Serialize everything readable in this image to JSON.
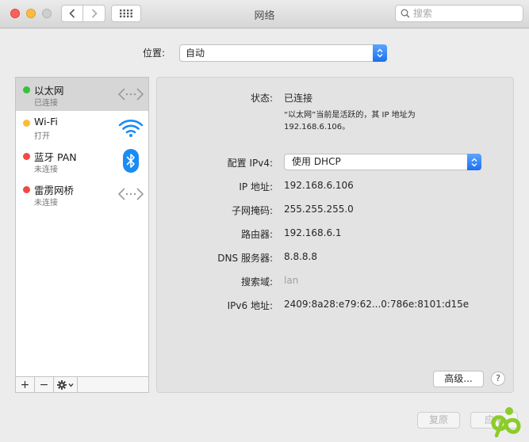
{
  "window": {
    "title": "网络",
    "search_placeholder": "搜索"
  },
  "location": {
    "label": "位置:",
    "value": "自动"
  },
  "services": [
    {
      "name": "以太网",
      "status": "已连接",
      "status_color": "#36c23b",
      "icon": "ethernet-arrows-icon"
    },
    {
      "name": "Wi-Fi",
      "status": "打开",
      "status_color": "#fbbc33",
      "icon": "wifi-icon"
    },
    {
      "name": "蓝牙 PAN",
      "status": "未连接",
      "status_color": "#f24a43",
      "icon": "bluetooth-icon"
    },
    {
      "name": "雷雳网桥",
      "status": "未连接",
      "status_color": "#f24a43",
      "icon": "ethernet-arrows-icon"
    }
  ],
  "toolbar": {
    "add": "+",
    "remove": "−"
  },
  "detail": {
    "status_label": "状态:",
    "status_value": "已连接",
    "status_desc_1": "“以太网”当前是活跃的，其 IP 地址为",
    "status_desc_2": "192.168.6.106。",
    "config_label": "配置 IPv4:",
    "config_value": "使用 DHCP",
    "ip_label": "IP 地址:",
    "ip_value": "192.168.6.106",
    "mask_label": "子网掩码:",
    "mask_value": "255.255.255.0",
    "router_label": "路由器:",
    "router_value": "192.168.6.1",
    "dns_label": "DNS 服务器:",
    "dns_value": "8.8.8.8",
    "search_domain_label": "搜索域:",
    "search_domain_value": "lan",
    "ipv6_label": "IPv6 地址:",
    "ipv6_value": "2409:8a28:e79:62...0:786e:8101:d15e",
    "advanced_label": "高级...",
    "help_label": "?"
  },
  "footer": {
    "revert_label": "复原",
    "apply_label": "应用"
  },
  "colors": {
    "accent": "#1e6ff2",
    "selected_row": "#d6d6d6",
    "bluetooth": "#1a8cf5",
    "wifi": "#1a8cf5",
    "logo_green": "#8ccc2a"
  }
}
